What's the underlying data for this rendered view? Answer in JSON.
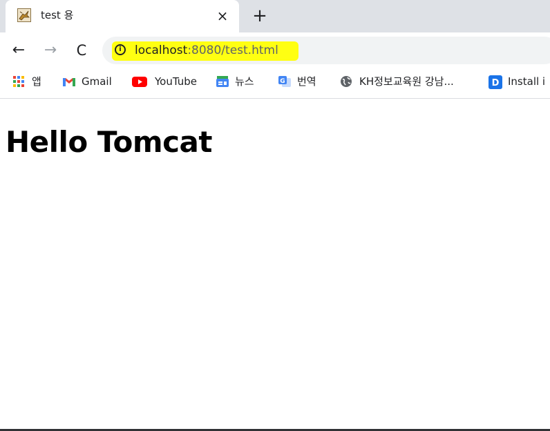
{
  "tab": {
    "title": "test 용",
    "close": "×"
  },
  "newtab": "+",
  "nav": {
    "back": "←",
    "forward": "→",
    "reload": "C"
  },
  "address": {
    "host": "localhost",
    "rest": ":8080/test.html",
    "info": "i"
  },
  "bookmarks": [
    {
      "label": "앱",
      "icon": "apps-grid-icon"
    },
    {
      "label": "Gmail",
      "icon": "gmail-icon"
    },
    {
      "label": "YouTube",
      "icon": "youtube-icon"
    },
    {
      "label": "뉴스",
      "icon": "google-news-icon"
    },
    {
      "label": "번역",
      "icon": "google-translate-icon"
    },
    {
      "label": "KH정보교육원 강남...",
      "icon": "globe-icon"
    },
    {
      "label": "Install i",
      "icon": "d-app-icon"
    }
  ],
  "page": {
    "heading": "Hello Tomcat"
  },
  "colors": {
    "highlight": "#ffff12",
    "tabstrip": "#dee1e6",
    "omnibox": "#f1f3f4"
  }
}
